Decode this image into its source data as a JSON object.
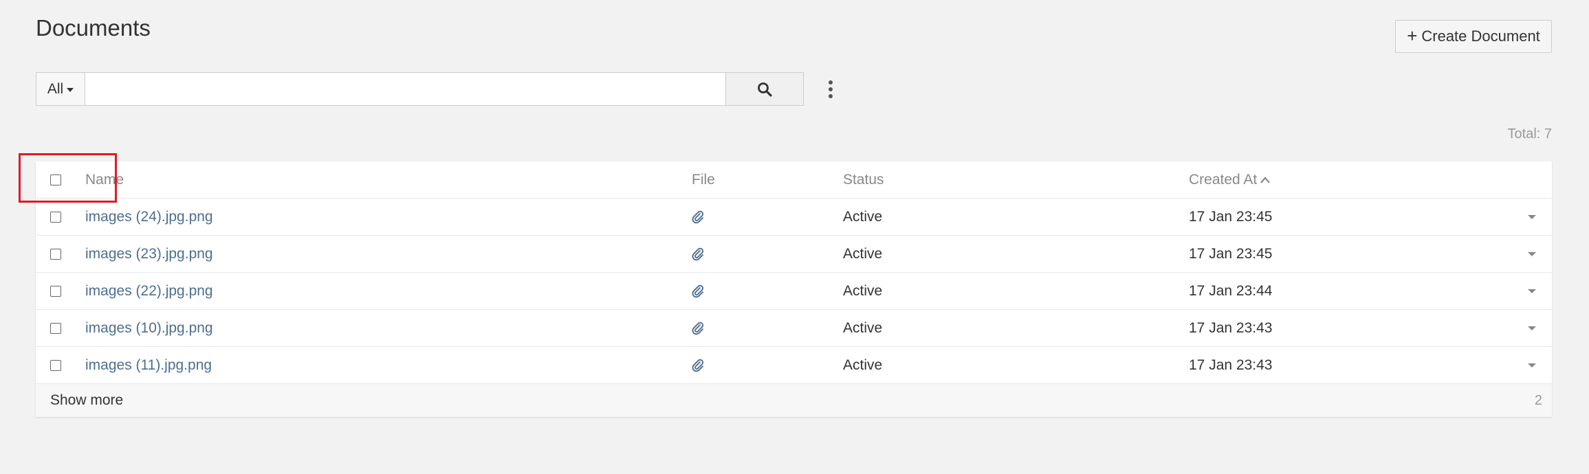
{
  "header": {
    "title": "Documents",
    "create_label": "Create Document",
    "create_icon": "plus-icon"
  },
  "search": {
    "filter_label": "All",
    "query": "",
    "placeholder": ""
  },
  "summary": {
    "total_label": "Total: 7"
  },
  "table": {
    "columns": {
      "name": "Name",
      "file": "File",
      "status": "Status",
      "created_at": "Created At"
    },
    "sort": {
      "column": "created_at",
      "direction": "ascending-indicator"
    },
    "rows": [
      {
        "name": "images (24).jpg.png",
        "status": "Active",
        "created_at": "17 Jan 23:45"
      },
      {
        "name": "images (23).jpg.png",
        "status": "Active",
        "created_at": "17 Jan 23:45"
      },
      {
        "name": "images (22).jpg.png",
        "status": "Active",
        "created_at": "17 Jan 23:44"
      },
      {
        "name": "images (10).jpg.png",
        "status": "Active",
        "created_at": "17 Jan 23:43"
      },
      {
        "name": "images (11).jpg.png",
        "status": "Active",
        "created_at": "17 Jan 23:43"
      }
    ],
    "footer": {
      "show_more_label": "Show more",
      "remaining_count": "2"
    }
  },
  "colors": {
    "link": "#4d6e8f",
    "highlight": "#e01b24",
    "background": "#f2f2f2"
  }
}
